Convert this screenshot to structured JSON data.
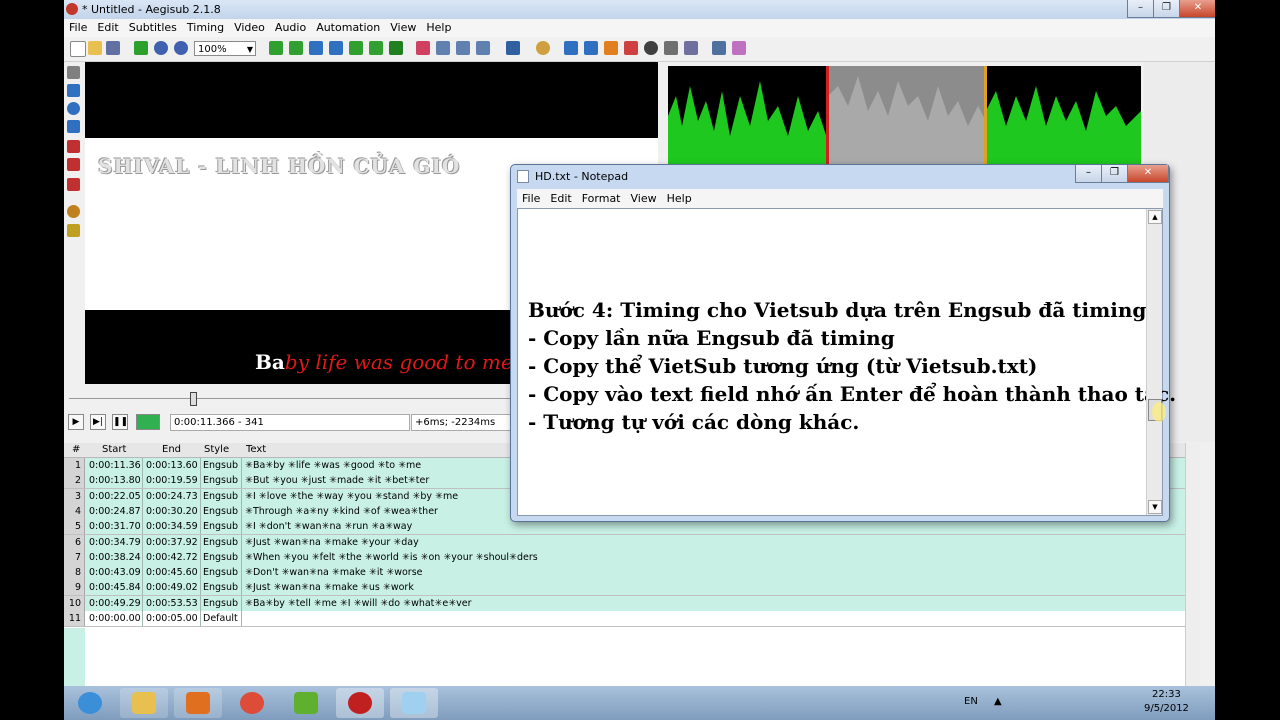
{
  "window": {
    "title": "* Untitled - Aegisub 2.1.8"
  },
  "menu": [
    "File",
    "Edit",
    "Subtitles",
    "Timing",
    "Video",
    "Audio",
    "Automation",
    "View",
    "Help"
  ],
  "toolbar": {
    "zoom": "100%"
  },
  "video": {
    "top_sub": "SHIVAL - LINH HỒN CỦA GIÓ",
    "bottom_sub_a": "Ba",
    "bottom_sub_b": "by life was good to me"
  },
  "controls": {
    "time": "0:00:11.366 - 341",
    "offset": "+6ms; -2234ms"
  },
  "grid": {
    "headers": [
      "#",
      "Start",
      "End",
      "Style",
      "Text"
    ],
    "rows": [
      {
        "n": "1",
        "start": "0:00:11.36",
        "end": "0:00:13.60",
        "style": "Engsub",
        "text": "✳Ba✳by ✳life ✳was ✳good ✳to ✳me"
      },
      {
        "n": "2",
        "start": "0:00:13.80",
        "end": "0:00:19.59",
        "style": "Engsub",
        "text": "✳But ✳you ✳just ✳made ✳it ✳bet✳ter"
      },
      {
        "n": "3",
        "start": "0:00:22.05",
        "end": "0:00:24.73",
        "style": "Engsub",
        "text": "✳I ✳love ✳the ✳way ✳you ✳stand ✳by ✳me"
      },
      {
        "n": "4",
        "start": "0:00:24.87",
        "end": "0:00:30.20",
        "style": "Engsub",
        "text": "✳Through ✳a✳ny ✳kind ✳of ✳wea✳ther"
      },
      {
        "n": "5",
        "start": "0:00:31.70",
        "end": "0:00:34.59",
        "style": "Engsub",
        "text": "✳I ✳don't ✳wan✳na ✳run ✳a✳way"
      },
      {
        "n": "6",
        "start": "0:00:34.79",
        "end": "0:00:37.92",
        "style": "Engsub",
        "text": "✳Just ✳wan✳na ✳make ✳your ✳day"
      },
      {
        "n": "7",
        "start": "0:00:38.24",
        "end": "0:00:42.72",
        "style": "Engsub",
        "text": "✳When ✳you ✳felt ✳the ✳world ✳is ✳on ✳your ✳shoul✳ders"
      },
      {
        "n": "8",
        "start": "0:00:43.09",
        "end": "0:00:45.60",
        "style": "Engsub",
        "text": "✳Don't ✳wan✳na ✳make ✳it ✳worse"
      },
      {
        "n": "9",
        "start": "0:00:45.84",
        "end": "0:00:49.02",
        "style": "Engsub",
        "text": "✳Just ✳wan✳na ✳make ✳us ✳work"
      },
      {
        "n": "10",
        "start": "0:00:49.29",
        "end": "0:00:53.53",
        "style": "Engsub",
        "text": "✳Ba✳by ✳tell ✳me ✳I ✳will ✳do ✳what✳e✳ver"
      },
      {
        "n": "11",
        "start": "0:00:00.00",
        "end": "0:00:05.00",
        "style": "Default",
        "text": ""
      }
    ]
  },
  "notepad": {
    "title": "HD.txt - Notepad",
    "menu": [
      "File",
      "Edit",
      "Format",
      "View",
      "Help"
    ],
    "lines": [
      "Bước 4: Timing cho Vietsub dựa trên Engsub đã timing",
      "- Copy lần nữa Engsub đã timing",
      "- Copy thể VietSub tương ứng (từ Vietsub.txt)",
      "- Copy vào text field nhớ ấn Enter để hoàn thành thao tác.",
      "- Tương tự với các dòng khác."
    ]
  },
  "taskbar": {
    "lang": "EN",
    "time": "22:33",
    "date": "9/5/2012"
  },
  "colors": {
    "grid_row": "#c8f0e4",
    "waveform": "#1ec81e",
    "sub_red": "#e01818"
  }
}
